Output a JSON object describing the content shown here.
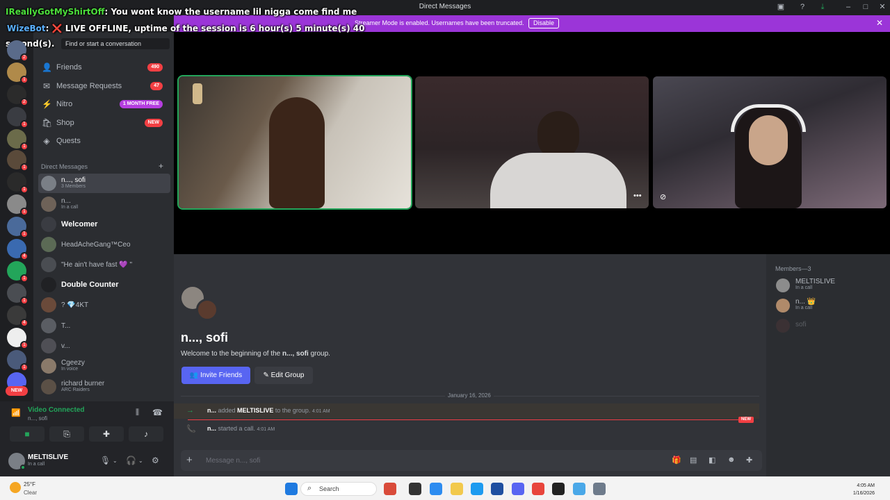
{
  "window": {
    "title": "Direct Messages"
  },
  "banner": {
    "message": "Streamer Mode is enabled. Usernames have been truncated.",
    "disable_label": "Disable",
    "color": "#9b35d8"
  },
  "overlay": {
    "line1_user": "IReallyGotMyShirtOff",
    "line1_text": ": You wont know the username lil nigga come find me",
    "line2_user": "WizeBot",
    "line2_text": ": ❌ LIVE OFFLINE, uptime of the session is 6 hour(s) 5 minute(s) 40",
    "line3_text": "second(s)."
  },
  "search": {
    "placeholder": "Find or start a conversation"
  },
  "nav": [
    {
      "label": "Friends",
      "badge": "490",
      "icon": "friends-icon"
    },
    {
      "label": "Message Requests",
      "badge": "47",
      "icon": "mail-icon"
    },
    {
      "label": "Nitro",
      "badge": "1 MONTH FREE",
      "icon": "nitro-icon"
    },
    {
      "label": "Shop",
      "badge": "NEW",
      "icon": "shop-icon"
    },
    {
      "label": "Quests",
      "badge": "",
      "icon": "quests-icon"
    }
  ],
  "dm_section": {
    "header": "Direct Messages",
    "items": [
      {
        "name": "n..., sofi",
        "sub": "3 Members"
      },
      {
        "name": "n...",
        "sub": "In a call"
      },
      {
        "name": "Welcomer",
        "sub": ""
      },
      {
        "name": "HeadAcheGang™Ceo",
        "sub": ""
      },
      {
        "name": "\"He ain't have fast 💜 \"",
        "sub": ""
      },
      {
        "name": "Double Counter",
        "sub": ""
      },
      {
        "name": "? 💎4KT",
        "sub": ""
      },
      {
        "name": "T...",
        "sub": ""
      },
      {
        "name": "v...",
        "sub": ""
      },
      {
        "name": "Cgeezy",
        "sub": "In voice"
      },
      {
        "name": "richard burner",
        "sub": "ARC Raiders"
      }
    ]
  },
  "rail": {
    "new_label": "NEW",
    "badges": [
      "2",
      "1",
      "2",
      "1",
      "1",
      "1",
      "1",
      "1",
      "1",
      "4",
      "1",
      "1",
      "4",
      "1",
      "1",
      "1"
    ]
  },
  "voice": {
    "status": "Video Connected",
    "channel": "n..., sofi"
  },
  "user": {
    "name": "MELTISLIVE",
    "status": "In a call"
  },
  "chat": {
    "group_title": "n..., sofi",
    "welcome_prefix": "Welcome to the beginning of the ",
    "welcome_name": "n..., sofi",
    "welcome_suffix": " group.",
    "invite_label": "Invite Friends",
    "edit_label": "Edit Group",
    "date": "January 16, 2026",
    "messages": [
      {
        "actor": "n...",
        "verb": " added ",
        "target": "MELTISLIVE",
        "rest": " to the group. ",
        "time": "4:01 AM"
      },
      {
        "actor": "n...",
        "verb": " started a call. ",
        "target": "",
        "rest": "",
        "time": "4:01 AM"
      }
    ],
    "new_label": "NEW",
    "composer_placeholder": "Message n..., sofi"
  },
  "members": {
    "header": "Members—3",
    "list": [
      {
        "name": "MELTISLIVE",
        "sub": "In a call"
      },
      {
        "name": "n... 👑",
        "sub": "In a call"
      },
      {
        "name": "sofi",
        "sub": ""
      }
    ]
  },
  "taskbar": {
    "temp": "25°F",
    "weather": "Clear",
    "search_label": "Search",
    "time": "4:05 AM",
    "date": "1/16/2026"
  }
}
